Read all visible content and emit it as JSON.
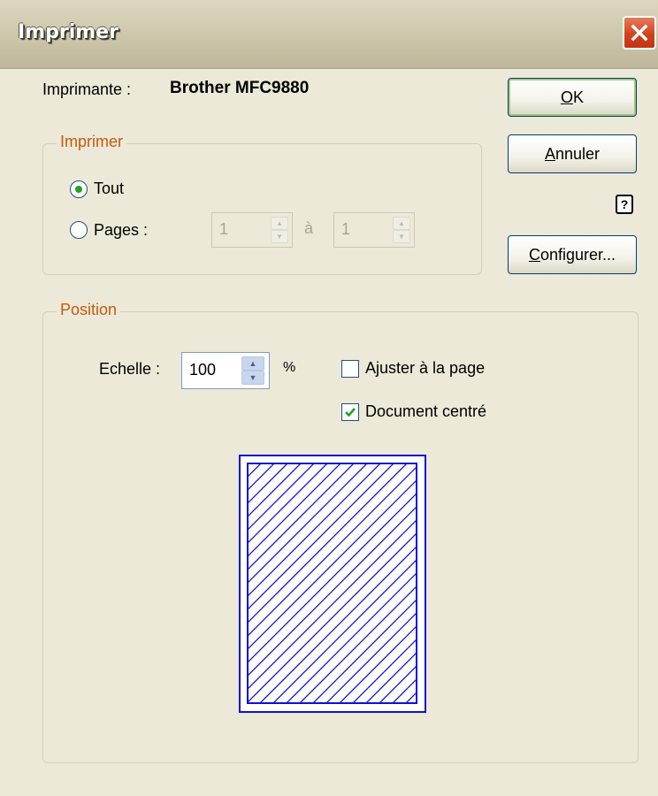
{
  "window": {
    "title": "Imprimer"
  },
  "printer": {
    "label": "Imprimante :",
    "name": "Brother MFC9880"
  },
  "print_group": {
    "legend": "Imprimer",
    "option_all": "Tout",
    "option_pages": "Pages :",
    "selected": "Tout",
    "from_value": "1",
    "to_label": "à",
    "to_value": "1"
  },
  "buttons": {
    "ok_label": "OK",
    "cancel_label": "Annuler",
    "configure_label": "Configurer...",
    "help_glyph": "?"
  },
  "position_group": {
    "legend": "Position",
    "scale_label": "Echelle :",
    "scale_value": "100",
    "scale_unit": "%",
    "fit_to_page_label": "Ajuster à la page",
    "fit_to_page_checked": false,
    "centered_label": "Document centré",
    "centered_checked": true
  },
  "colors": {
    "dialog_bg": "#ece9d8",
    "legend_text": "#c25b0c",
    "radio_dot": "#21a121",
    "check_mark": "#21a121",
    "preview_stroke": "#1010d0",
    "preview_shadow": "#8c8c8c"
  },
  "icons": {
    "close": "close-icon",
    "help": "help-icon",
    "spin_up": "spin-up-arrow-icon",
    "spin_down": "spin-down-arrow-icon",
    "check": "checkmark-icon"
  }
}
